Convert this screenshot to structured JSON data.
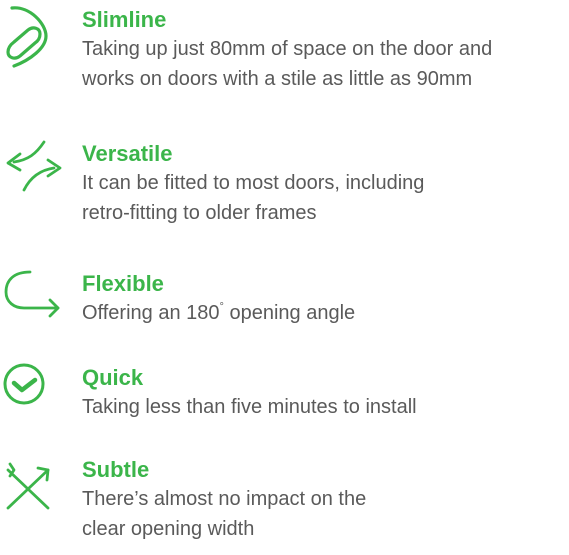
{
  "accent_color": "#3bb54a",
  "text_color": "#5a5a5a",
  "features": [
    {
      "icon": "capsule-icon",
      "title": "Slimline",
      "description": "Taking up just 80mm of space on the door and works on doors with a stile as little as 90mm"
    },
    {
      "icon": "swap-arrows-icon",
      "title": "Versatile",
      "description": "It can be fitted to most doors, including retro-fitting to older frames"
    },
    {
      "icon": "curved-arrow-icon",
      "title": "Flexible",
      "description_before": "Offering an 180",
      "description_degree": "°",
      "description_after": " opening angle"
    },
    {
      "icon": "check-circle-icon",
      "title": "Quick",
      "description": "Taking less than five minutes to install"
    },
    {
      "icon": "crossed-arrows-icon",
      "title": "Subtle",
      "description": "There’s almost no impact on the clear opening width"
    }
  ]
}
